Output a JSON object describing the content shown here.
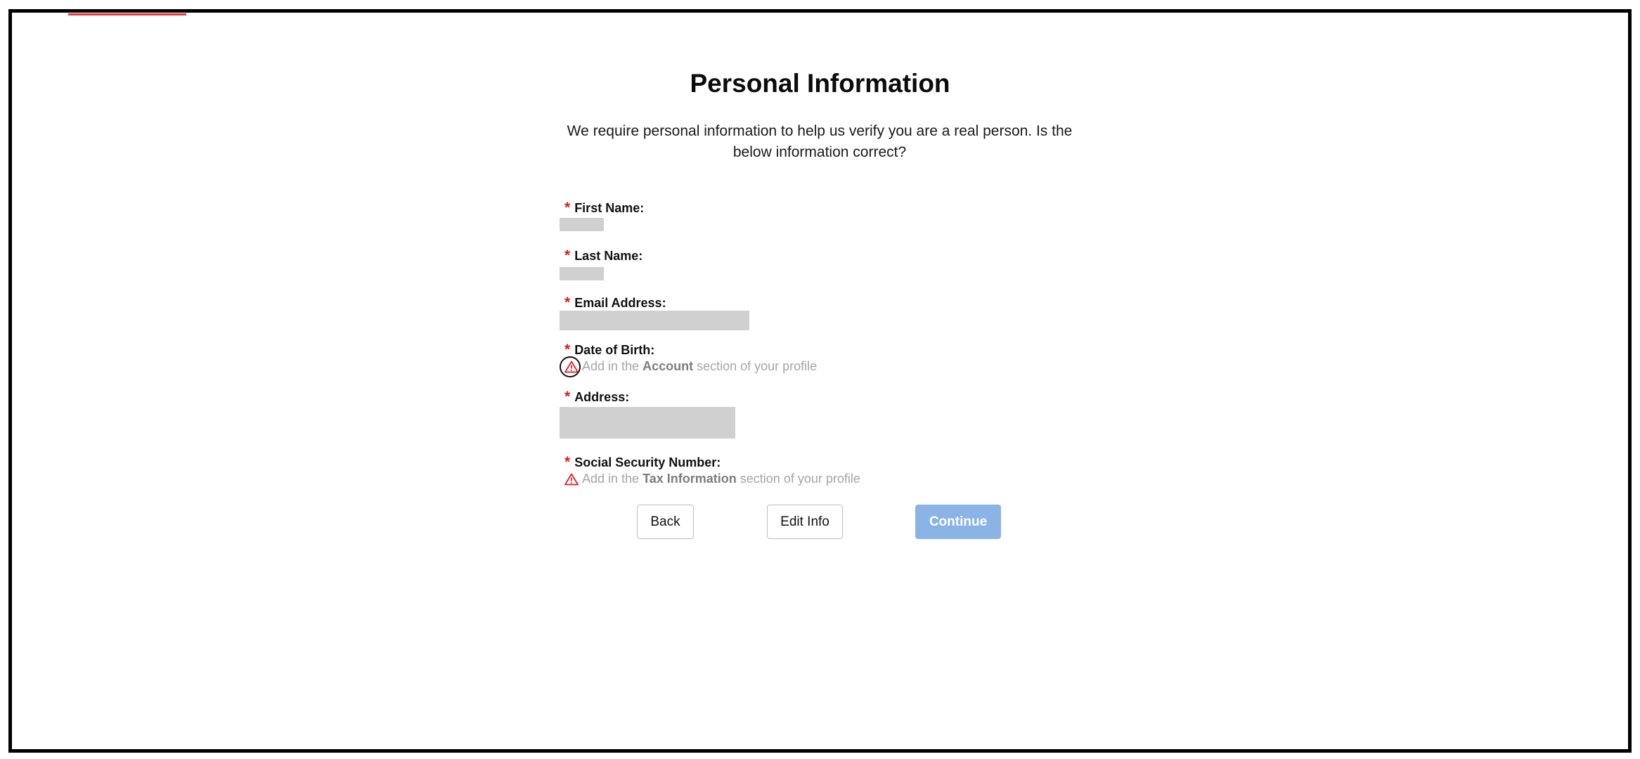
{
  "page": {
    "title": "Personal Information",
    "intro": "We require personal information to help us verify you are a real person. Is the below information correct?"
  },
  "fields": {
    "required_marker": "*",
    "first_name": {
      "label": "First Name:"
    },
    "last_name": {
      "label": "Last Name:"
    },
    "email": {
      "label": "Email Address:"
    },
    "dob": {
      "label": "Date of Birth:",
      "warning_prefix": "Add in the",
      "warning_section": "Account",
      "warning_suffix": "section of your profile"
    },
    "address": {
      "label": "Address:"
    },
    "ssn": {
      "label": "Social Security Number:",
      "warning_prefix": "Add in the",
      "warning_section": "Tax Information",
      "warning_suffix": "section of your profile"
    }
  },
  "buttons": {
    "back": "Back",
    "edit": "Edit Info",
    "continue": "Continue"
  },
  "colors": {
    "required": "#d32222",
    "warning_icon": "#d32222",
    "primary_disabled": "#8ab4e6",
    "redacted": "#d0d0d0"
  },
  "icons": {
    "warning": "warning-triangle-icon"
  }
}
